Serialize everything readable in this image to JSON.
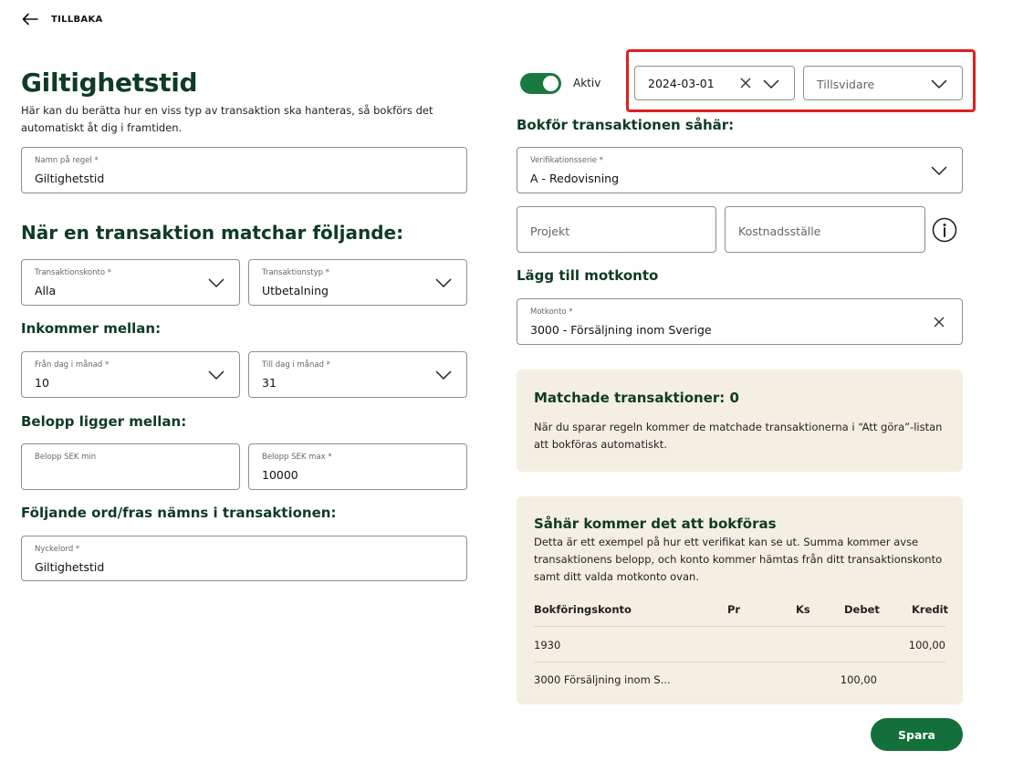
{
  "nav": {
    "back_label": "TILLBAKA"
  },
  "header": {
    "title": "Giltighetstid",
    "subtitle": "Här kan du berätta hur en viss typ av transaktion ska hanteras, så bokförs det automatiskt åt dig i framtiden."
  },
  "rule_name": {
    "label": "Namn på regel *",
    "value": "Giltighetstid"
  },
  "match_section": {
    "heading": "När en transaktion matchar följande:",
    "account": {
      "label": "Transaktionskonto *",
      "value": "Alla"
    },
    "type": {
      "label": "Transaktionstyp *",
      "value": "Utbetalning"
    },
    "income_heading": "Inkommer mellan:",
    "from_day": {
      "label": "Från dag i månad *",
      "value": "10"
    },
    "to_day": {
      "label": "Till dag i månad *",
      "value": "31"
    },
    "amount_heading": "Belopp ligger mellan:",
    "amount_min": {
      "label": "Belopp SEK min",
      "value": ""
    },
    "amount_max": {
      "label": "Belopp SEK max *",
      "value": "10000"
    },
    "keyword_heading": "Följande ord/fras nämns i transaktionen:",
    "keyword": {
      "label": "Nyckelord *",
      "value": "Giltighetstid"
    }
  },
  "validity": {
    "toggle_label": "Aktiv",
    "toggle_on": true,
    "start_date": "2024-03-01",
    "end_placeholder": "Tillsvidare"
  },
  "booking": {
    "heading": "Bokför transaktionen såhär:",
    "series": {
      "label": "Verifikationsserie *",
      "value": "A - Redovisning"
    },
    "project_placeholder": "Projekt",
    "cost_center_placeholder": "Kostnadsställe",
    "counter_heading": "Lägg till motkonto",
    "counter_account": {
      "label": "Motkonto *",
      "value": "3000 - Försäljning inom Sverige"
    }
  },
  "matched": {
    "title": "Matchade transaktioner: 0",
    "text": "När du sparar regeln kommer de matchade transaktionerna i “Att göra”-listan att bokföras automatiskt."
  },
  "preview": {
    "title": "Såhär kommer det att bokföras",
    "text": "Detta är ett exempel på hur ett verifikat kan se ut. Summa kommer avse transaktionens belopp, och konto kommer hämtas från ditt transaktionskonto samt ditt valda motkonto ovan.",
    "columns": {
      "account": "Bokföringskonto",
      "pr": "Pr",
      "ks": "Ks",
      "debit": "Debet",
      "credit": "Kredit"
    },
    "rows": [
      {
        "account": "1930",
        "pr": "",
        "ks": "",
        "debit": "",
        "credit": "100,00"
      },
      {
        "account": "3000 Försäljning inom S...",
        "pr": "",
        "ks": "",
        "debit": "100,00",
        "credit": ""
      }
    ]
  },
  "actions": {
    "save_label": "Spara"
  },
  "colors": {
    "brand_dark": "#0f3b24",
    "brand_green": "#13703a",
    "card_bg": "#f5efe3",
    "highlight": "#e02020"
  }
}
